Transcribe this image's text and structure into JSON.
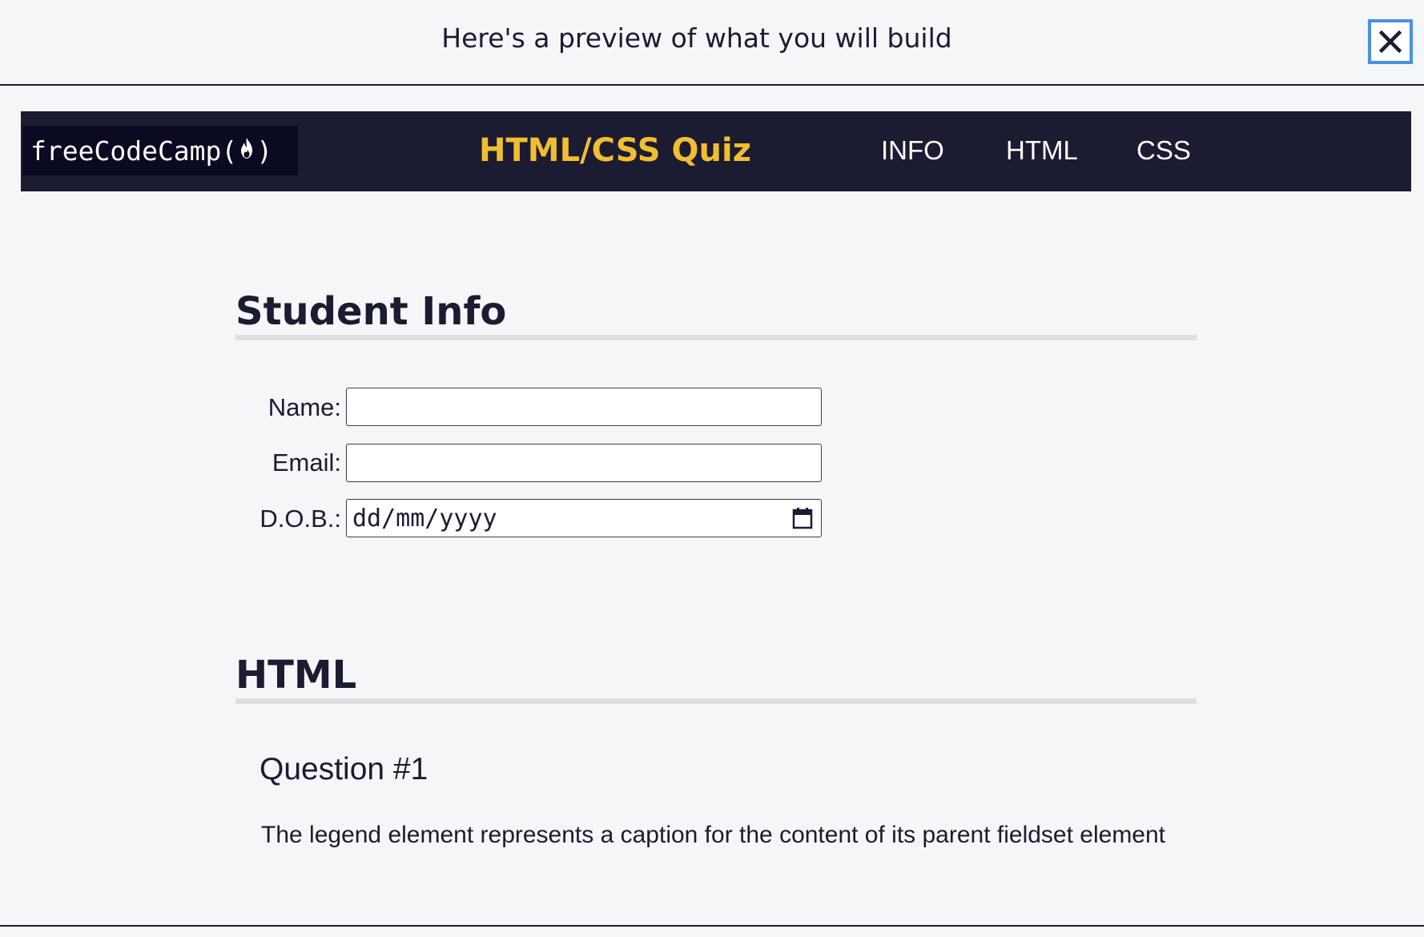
{
  "modal": {
    "title": "Here's a preview of what you will build",
    "close_icon": "close-icon"
  },
  "navbar": {
    "logo_text_left": "freeCodeCamp(",
    "logo_text_right": ")",
    "logo_icon": "flame-icon",
    "title": "HTML/CSS Quiz",
    "links": [
      {
        "label": "INFO"
      },
      {
        "label": "HTML"
      },
      {
        "label": "CSS"
      }
    ]
  },
  "student_info": {
    "heading": "Student Info",
    "fields": [
      {
        "label": "Name:",
        "value": ""
      },
      {
        "label": "Email:",
        "value": ""
      },
      {
        "label": "D.O.B.:",
        "placeholder": "dd/mm/yyyy",
        "icon": "calendar-icon"
      }
    ]
  },
  "html_section": {
    "heading": "HTML",
    "question_title": "Question #1",
    "question_text": "The legend element represents a caption for the content of its parent fieldset element"
  },
  "colors": {
    "background": "#f5f6f7",
    "navbar": "#1b1b32",
    "logo_bg": "#0a0a23",
    "accent": "#f1be32",
    "text": "#1b1b32",
    "rule": "#dfdfe2",
    "focus": "#4a90e2"
  }
}
